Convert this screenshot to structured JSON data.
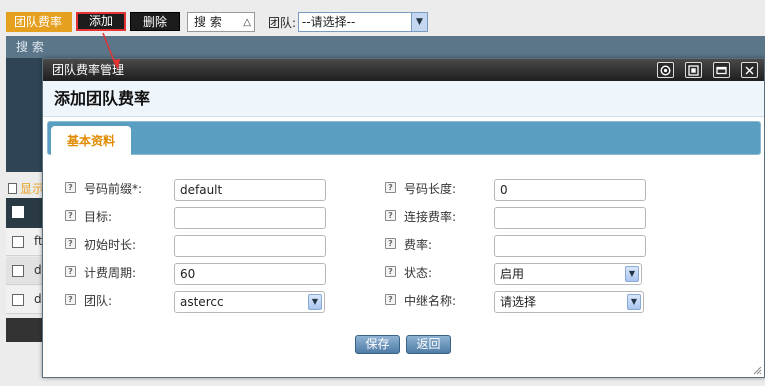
{
  "toolbar": {
    "title": "团队费率",
    "add_label": "添加",
    "delete_label": "删除",
    "search_label": "搜 索",
    "team_label": "团队:",
    "team_select_value": "--请选择--"
  },
  "search_panel": {
    "title": "搜 索"
  },
  "list": {
    "link_text": "显示",
    "rows": [
      "ft",
      "d",
      "d"
    ]
  },
  "dialog": {
    "title": "团队费率管理",
    "header": "添加团队费率",
    "tab": "基本资料",
    "fields": {
      "prefix": {
        "label": "号码前缀*:",
        "value": "default"
      },
      "length": {
        "label": "号码长度:",
        "value": "0"
      },
      "target": {
        "label": "目标:",
        "value": ""
      },
      "connect_rate": {
        "label": "连接费率:",
        "value": ""
      },
      "initial_duration": {
        "label": "初始时长:",
        "value": ""
      },
      "rate": {
        "label": "费率:",
        "value": ""
      },
      "billing_period": {
        "label": "计费周期:",
        "value": "60"
      },
      "status": {
        "label": "状态:",
        "value": "启用"
      },
      "team": {
        "label": "团队:",
        "value": "astercc"
      },
      "trunk_name": {
        "label": "中继名称:",
        "value": "请选择"
      }
    },
    "save_label": "保存",
    "back_label": "返回"
  },
  "icons": {
    "help": "help-icon",
    "dropdown": "chevron-down-icon",
    "window_controls": [
      "settings-icon",
      "maximize-icon",
      "restore-icon",
      "close-icon"
    ]
  },
  "colors": {
    "accent_orange": "#e6a020",
    "tab_blue": "#5a9fc2",
    "button_blue": "#4f7ca6",
    "callout_red": "#e23434"
  }
}
